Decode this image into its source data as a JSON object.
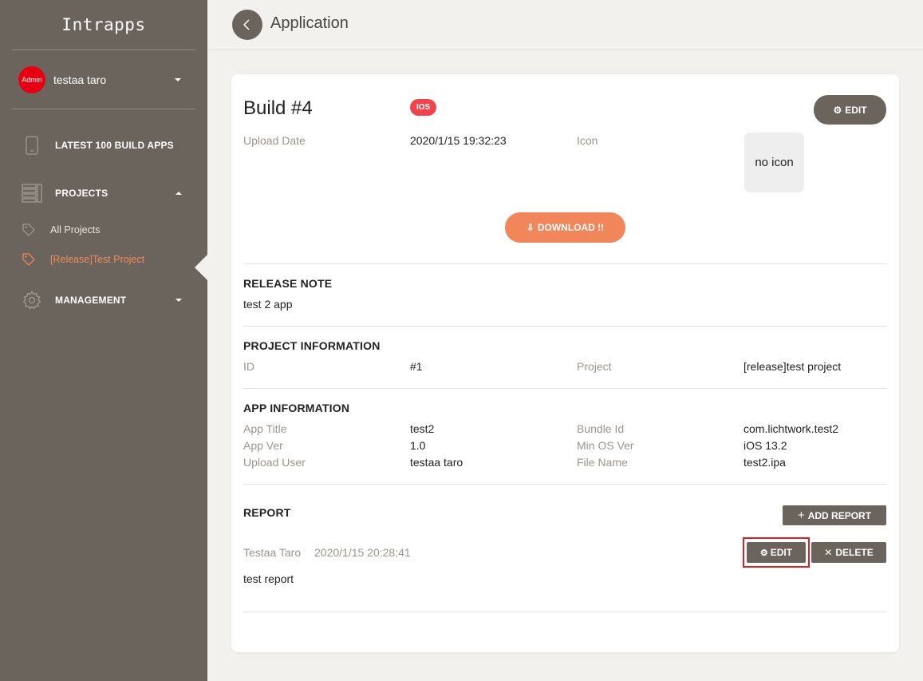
{
  "sidebar": {
    "brand": "Intrapps",
    "user": {
      "avatar_text": "Admin",
      "name": "testaa taro"
    },
    "nav": [
      {
        "label": "LATEST 100 BUILD APPS",
        "icon": "phone-icon"
      },
      {
        "label": "PROJECTS",
        "icon": "projects-list-icon"
      },
      {
        "label": "MANAGEMENT",
        "icon": "gear-icon"
      }
    ],
    "projects": [
      {
        "label": "All Projects",
        "icon": "tag-icon",
        "active": false
      },
      {
        "label": "[Release]Test Project",
        "icon": "tag-icon",
        "active": true
      }
    ],
    "active_color": "#f08a5a"
  },
  "header": {
    "title": "Application"
  },
  "build": {
    "title": "Build #4",
    "platform_badge": "IOS",
    "edit_label": "EDIT",
    "upload_date_label": "Upload Date",
    "upload_date_value": "2020/1/15 19:32:23",
    "icon_label": "Icon",
    "no_icon_text": "no icon",
    "download_label": "DOWNLOAD !!"
  },
  "release_note": {
    "title": "RELEASE NOTE",
    "text": "test 2 app"
  },
  "project_info": {
    "title": "PROJECT INFORMATION",
    "id_label": "ID",
    "id_value": "#1",
    "project_label": "Project",
    "project_value": "[release]test project"
  },
  "app_info": {
    "title": "APP INFORMATION",
    "rows": [
      {
        "l1": "App Title",
        "v1": "test2",
        "l2": "Bundle Id",
        "v2": "com.lichtwork.test2"
      },
      {
        "l1": "App Ver",
        "v1": "1.0",
        "l2": "Min OS Ver",
        "v2": "iOS 13.2"
      },
      {
        "l1": "Upload User",
        "v1": "testaa taro",
        "l2": "File Name",
        "v2": "test2.ipa"
      }
    ]
  },
  "report": {
    "title": "REPORT",
    "add_label": "ADD REPORT",
    "entries": [
      {
        "author": "Testaa Taro",
        "date": "2020/1/15 20:28:41",
        "text": "test report",
        "edit_label": "EDIT",
        "delete_label": "DELETE"
      }
    ]
  },
  "colors": {
    "sidebar": "#6b645c",
    "accent": "#f0865a",
    "badge": "#f0434b",
    "highlight": "#e0201f"
  }
}
